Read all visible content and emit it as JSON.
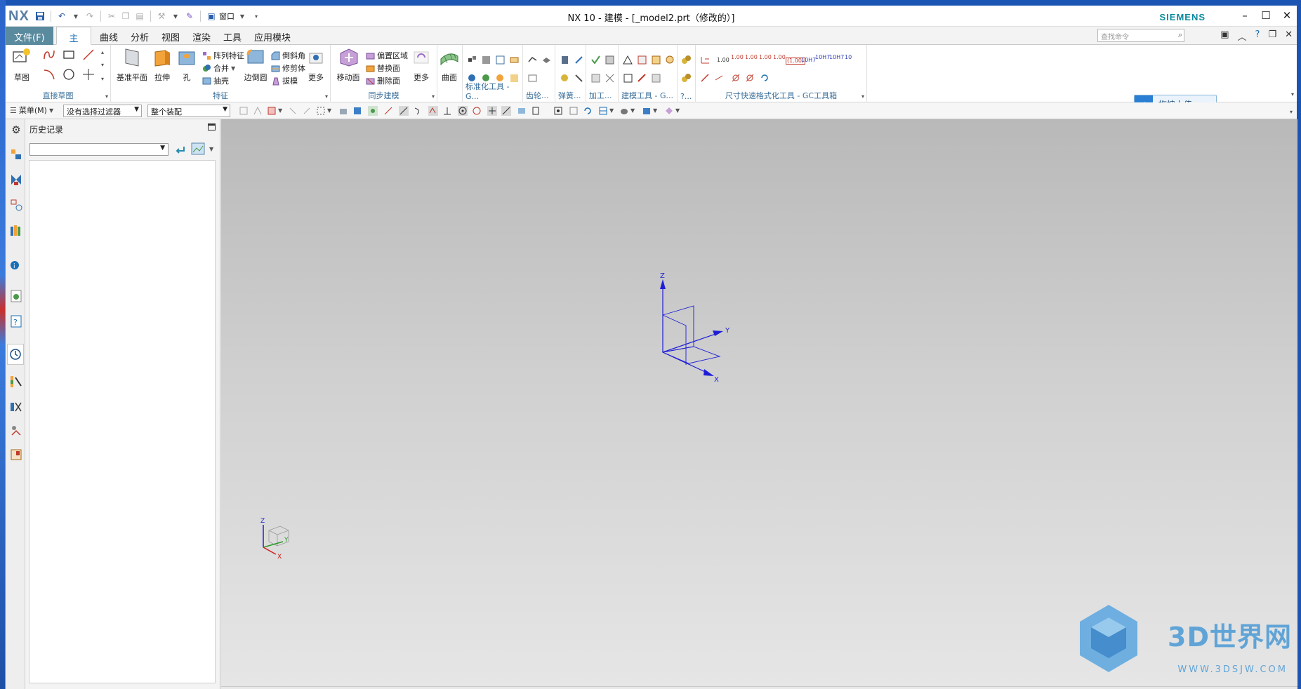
{
  "app": {
    "logo": "NX",
    "title": "NX 10 - 建模 - [_model2.prt（修改的）]",
    "brand": "SIEMENS"
  },
  "quick_access": {
    "window_menu": "窗口"
  },
  "tabs": [
    {
      "label": "文件(F)"
    },
    {
      "label": "主页"
    },
    {
      "label": "曲线"
    },
    {
      "label": "分析"
    },
    {
      "label": "视图"
    },
    {
      "label": "渲染"
    },
    {
      "label": "工具"
    },
    {
      "label": "应用模块"
    }
  ],
  "search": {
    "placeholder": "查找命令"
  },
  "ribbon": {
    "sketch": {
      "label": "草图",
      "group": "直接草图"
    },
    "feature": {
      "group": "特征",
      "datum_plane": "基准平面",
      "extrude": "拉伸",
      "hole": "孔",
      "pattern": "阵列特征",
      "unite": "合并",
      "shell": "抽壳",
      "edge_blend": "边倒圆",
      "chamfer": "倒斜角",
      "trim_body": "修剪体",
      "draft": "拔模",
      "more": "更多"
    },
    "sync": {
      "group": "同步建模",
      "move_face": "移动面",
      "offset_region": "偏置区域",
      "replace_face": "替换面",
      "delete_face": "删除面",
      "more": "更多"
    },
    "surface": {
      "label": "曲面"
    },
    "gc_groups": {
      "standard": "标准化工具 - G...",
      "gear": "齿轮...",
      "spring": "弹簧...",
      "machining": "加工...",
      "modeling": "建模工具 - G...",
      "short": "?...",
      "dimension": "尺寸快速格式化工具 - GC工具箱"
    },
    "dim_labels": [
      "1.00",
      "1.00",
      "1.00",
      "1.00",
      "1.00",
      "(1.00)",
      "10H7",
      "10H7",
      "10H7",
      "10"
    ]
  },
  "toolbar": {
    "menu": "菜单(M)",
    "filter": "没有选择过滤器",
    "scope": "整个装配",
    "upload": "拖拽上传"
  },
  "panel": {
    "title": "历史记录"
  },
  "viewport": {
    "axes": {
      "x": "X",
      "y": "Y",
      "z": "Z"
    },
    "watermark": "3D世界网",
    "watermark_url": "WWW.3DSJW.COM"
  },
  "colors": {
    "accent": "#1a6fb5",
    "file_tab": "#5a8a9e",
    "axis": "#1e1ed8",
    "brand": "#0a8a9e"
  }
}
